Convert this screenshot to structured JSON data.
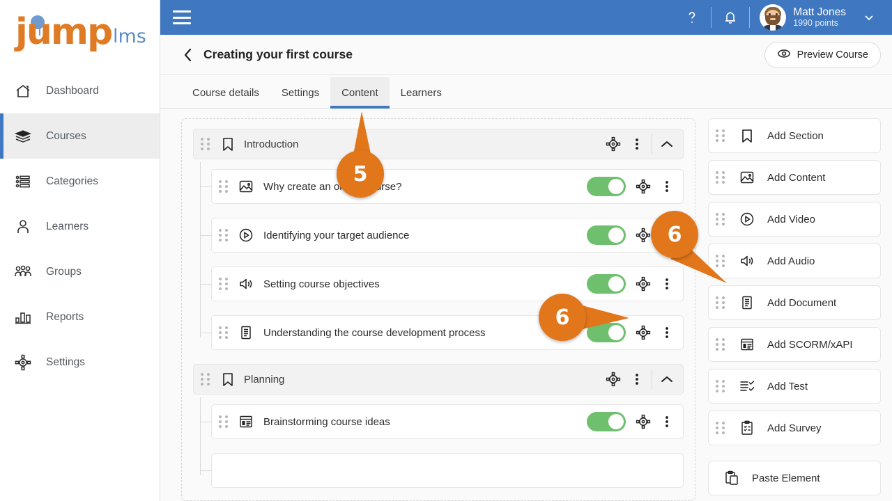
{
  "brand": {
    "name": "jump",
    "suffix": "lms",
    "orange": "#e07b25",
    "blue": "#5b8dc8"
  },
  "sidebar": {
    "items": [
      {
        "label": "Dashboard",
        "icon": "home-icon",
        "active": false
      },
      {
        "label": "Courses",
        "icon": "books-icon",
        "active": true
      },
      {
        "label": "Categories",
        "icon": "list-icon",
        "active": false
      },
      {
        "label": "Learners",
        "icon": "user-icon",
        "active": false
      },
      {
        "label": "Groups",
        "icon": "users-icon",
        "active": false
      },
      {
        "label": "Reports",
        "icon": "bar-chart-icon",
        "active": false
      },
      {
        "label": "Settings",
        "icon": "gear-icon",
        "active": false
      }
    ]
  },
  "topbar": {
    "menu_icon": "hamburger-icon",
    "help_icon": "question-mark-icon",
    "bell_icon": "bell-icon",
    "user": {
      "name": "Matt Jones",
      "points": "1990 points",
      "avatar": "avatar-icon",
      "chevron": "chevron-down-icon"
    }
  },
  "page": {
    "back_icon": "chevron-left-icon",
    "title": "Creating your first course",
    "preview_button": {
      "label": "Preview Course",
      "icon": "eye-icon"
    }
  },
  "tabs": [
    {
      "label": "Course details",
      "active": false
    },
    {
      "label": "Settings",
      "active": false
    },
    {
      "label": "Content",
      "active": true
    },
    {
      "label": "Learners",
      "active": false
    }
  ],
  "content": {
    "sections": [
      {
        "title": "Introduction",
        "icon": "bookmark-icon",
        "gear_icon": "settings-gear-icon",
        "menu_icon": "kebab-menu-icon",
        "collapse_icon": "chevron-up-icon",
        "items": [
          {
            "title": "Why create an online course?",
            "icon": "image-icon",
            "toggle": "on"
          },
          {
            "title": "Identifying your target audience",
            "icon": "play-circle-icon",
            "toggle": "on"
          },
          {
            "title": "Setting course objectives",
            "icon": "speaker-icon",
            "toggle": "on"
          },
          {
            "title": "Understanding the course development process",
            "icon": "document-icon",
            "toggle": "on"
          }
        ]
      },
      {
        "title": "Planning",
        "icon": "bookmark-icon",
        "gear_icon": "settings-gear-icon",
        "menu_icon": "kebab-menu-icon",
        "collapse_icon": "chevron-up-icon",
        "items": [
          {
            "title": "Brainstorming course ideas",
            "icon": "scorm-icon",
            "toggle": "on"
          }
        ]
      }
    ]
  },
  "tools": [
    {
      "label": "Add Section",
      "icon": "bookmark-icon"
    },
    {
      "label": "Add Content",
      "icon": "image-icon"
    },
    {
      "label": "Add Video",
      "icon": "play-circle-icon"
    },
    {
      "label": "Add Audio",
      "icon": "speaker-icon"
    },
    {
      "label": "Add Document",
      "icon": "document-icon"
    },
    {
      "label": "Add SCORM/xAPI",
      "icon": "scorm-icon"
    },
    {
      "label": "Add Test",
      "icon": "test-icon"
    },
    {
      "label": "Add Survey",
      "icon": "survey-icon"
    },
    {
      "label": "Paste Element",
      "icon": "paste-icon"
    }
  ],
  "callouts": [
    {
      "number": "5",
      "target": "content-tab"
    },
    {
      "number": "6",
      "target": "add-audio-button"
    },
    {
      "number": "6",
      "target": "row-gear-setting-course-objectives"
    }
  ],
  "colors": {
    "header_blue": "#3f77c0",
    "toggle_green": "#6ec06e",
    "callout_orange": "#e2761b"
  }
}
